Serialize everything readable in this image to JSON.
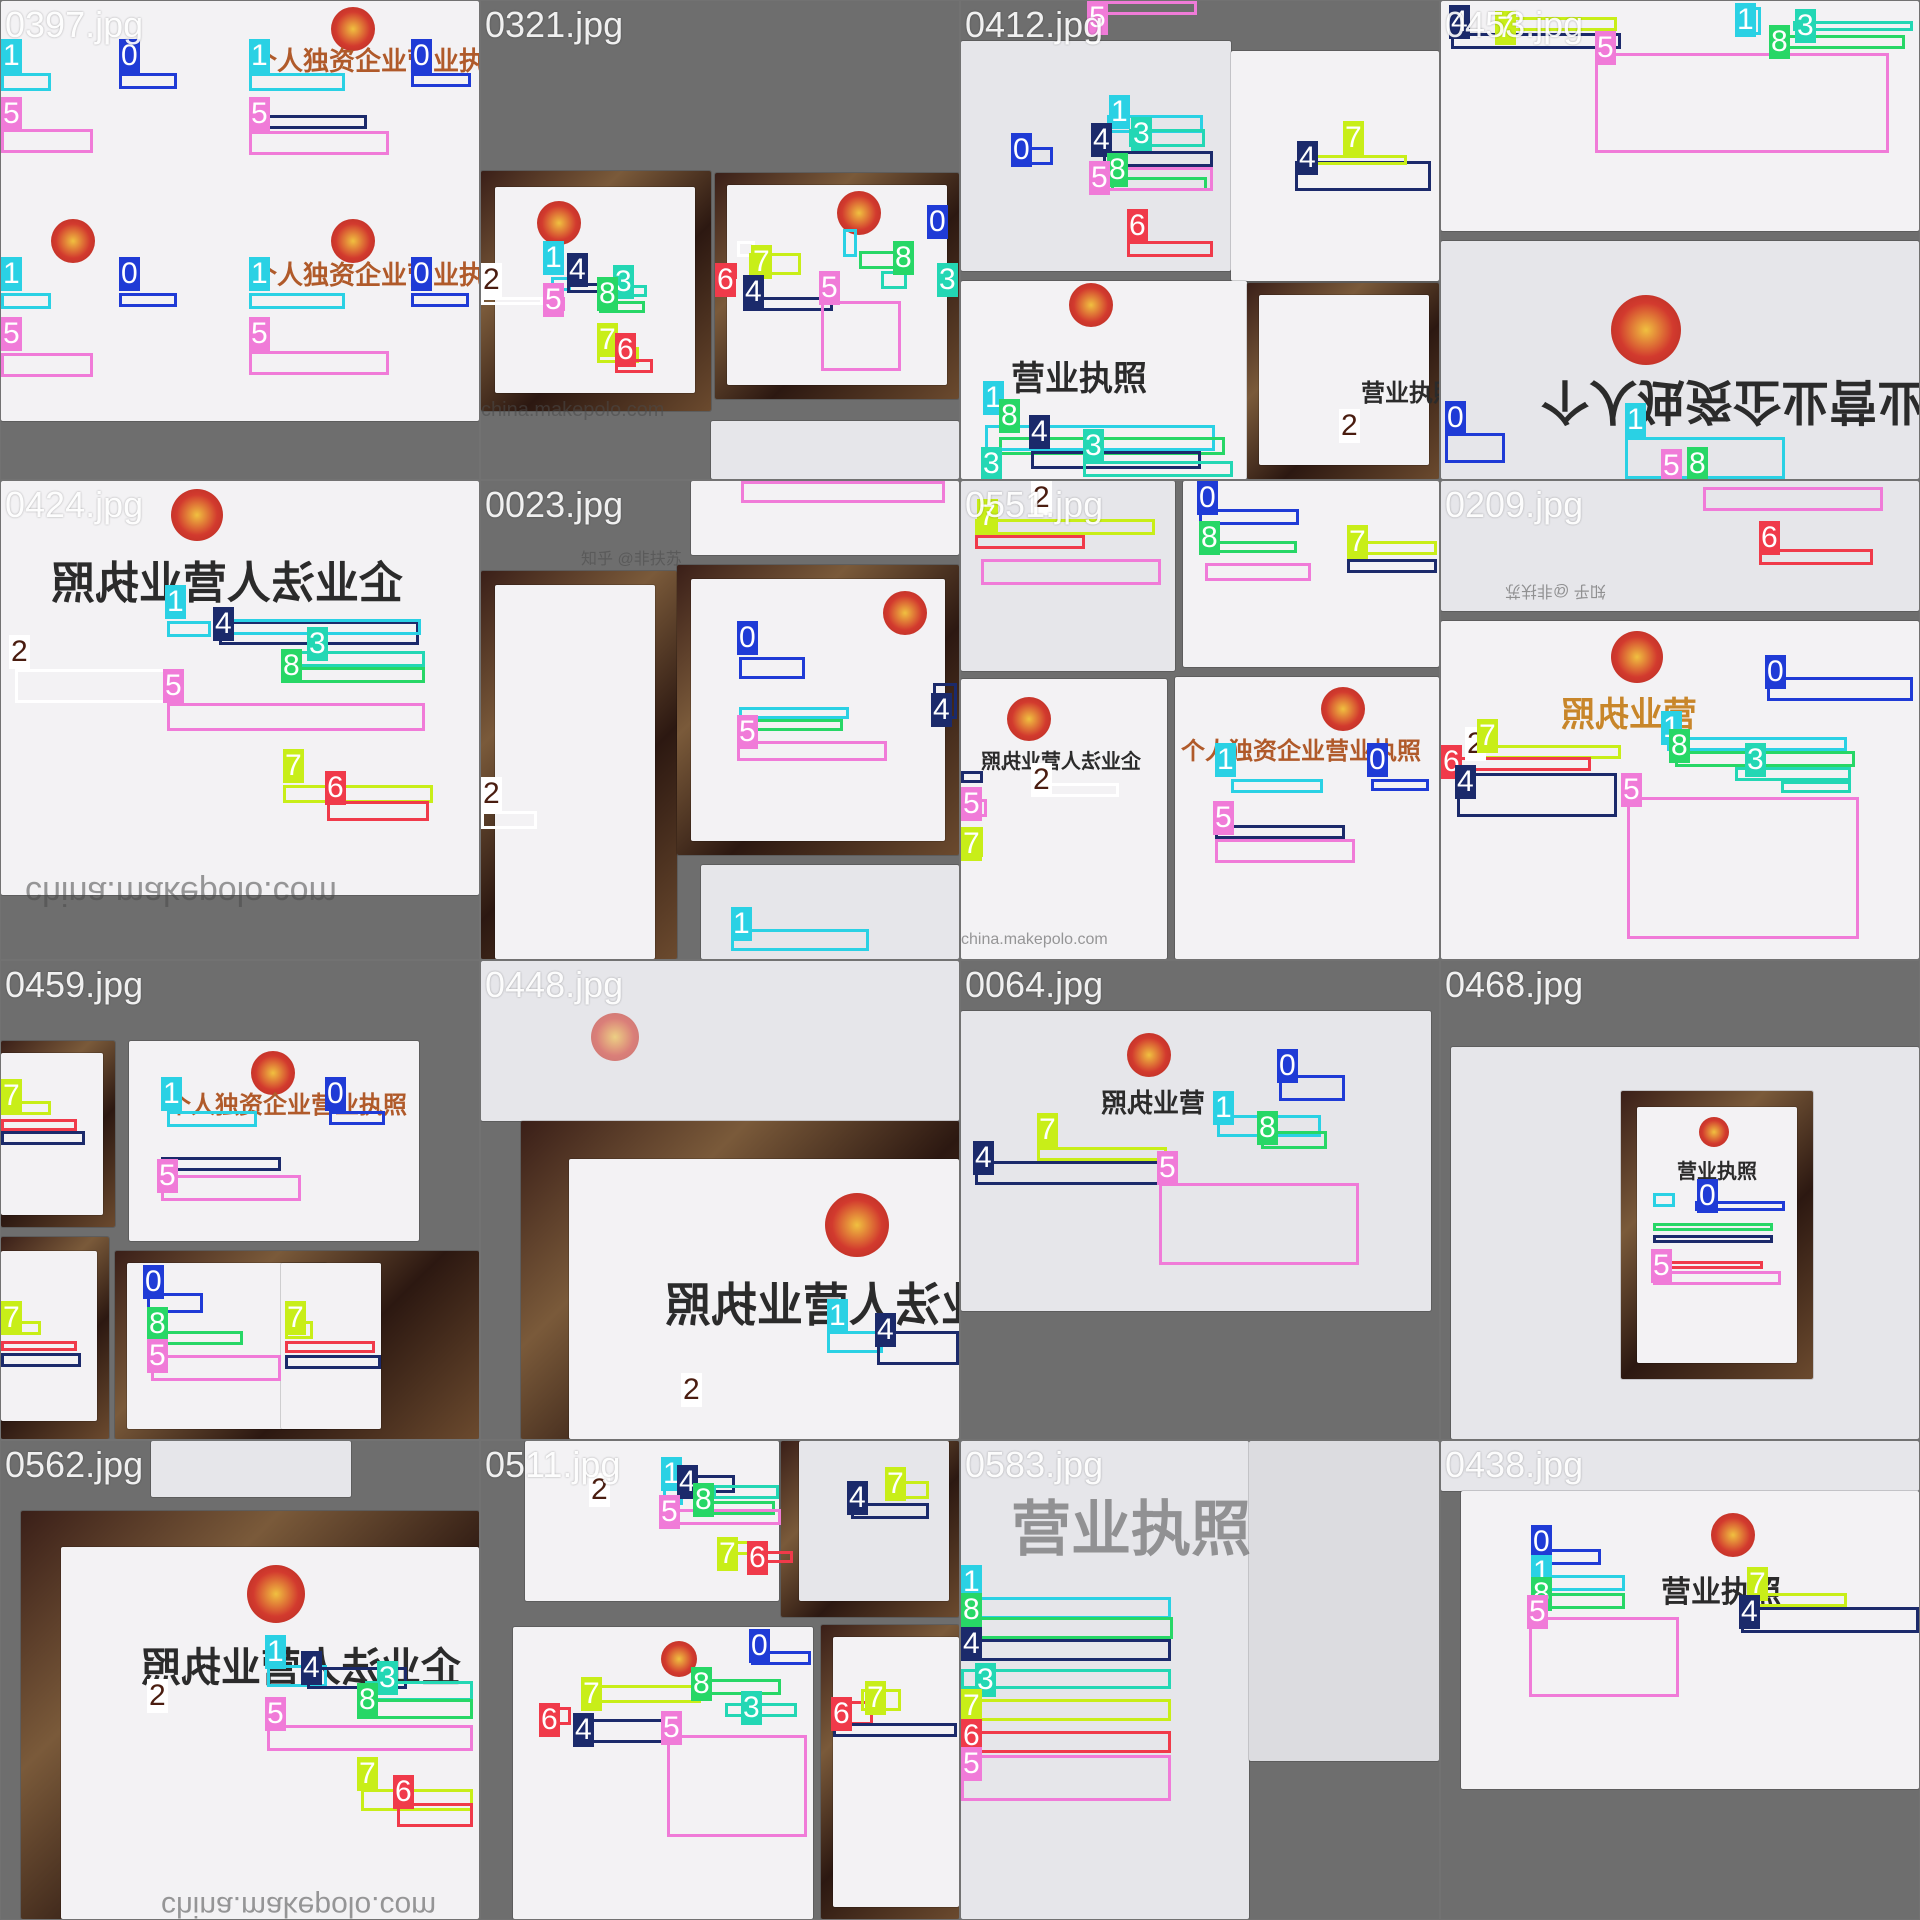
{
  "tiles": [
    {
      "name": "0397.jpg"
    },
    {
      "name": "0321.jpg"
    },
    {
      "name": "0412.jpg"
    },
    {
      "name": "0453.jpg"
    },
    {
      "name": "0424.jpg"
    },
    {
      "name": "0023.jpg"
    },
    {
      "name": "0551.jpg"
    },
    {
      "name": "0209.jpg"
    },
    {
      "name": "0459.jpg"
    },
    {
      "name": "0448.jpg"
    },
    {
      "name": "0064.jpg"
    },
    {
      "name": "0468.jpg"
    },
    {
      "name": "0562.jpg"
    },
    {
      "name": "0511.jpg"
    },
    {
      "name": "0583.jpg"
    },
    {
      "name": "0438.jpg"
    }
  ],
  "headings": {
    "sole_prop": "个人独资企业营业执照",
    "legal_person": "企业法人营业执照",
    "business": "营业执照"
  },
  "watermarks": {
    "makepolo": "china.makepolo.com",
    "zhihu": "知乎 @非扶苏"
  },
  "class_colors": {
    "0": "#1f3bd6",
    "1": "#2ad1e4",
    "2": "#ffffff",
    "3": "#23d7b4",
    "4": "#1b2a6b",
    "5": "#f07bd8",
    "6": "#f03a4a",
    "7": "#c8ee18",
    "8": "#27d766"
  }
}
